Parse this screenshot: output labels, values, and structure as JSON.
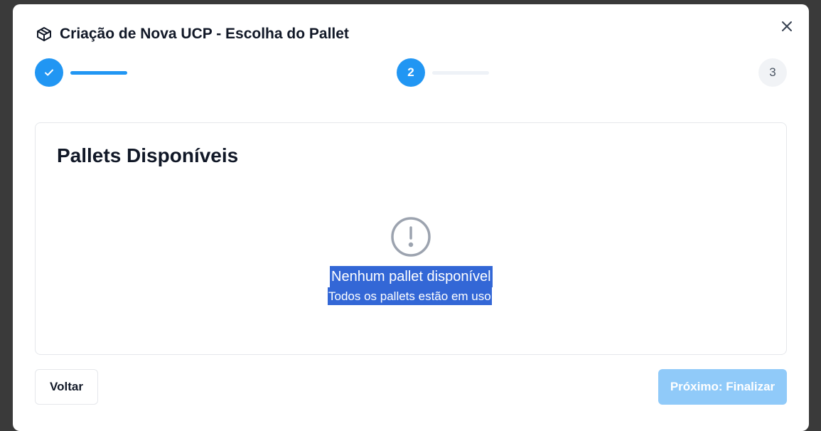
{
  "modal": {
    "title": "Criação de Nova UCP - Escolha do Pallet",
    "title_icon": "package-icon",
    "close_icon": "close-icon"
  },
  "stepper": {
    "steps": [
      {
        "label": "",
        "state": "completed",
        "icon": "check-icon"
      },
      {
        "label": "2",
        "state": "active"
      },
      {
        "label": "3",
        "state": "pending"
      }
    ],
    "progress": [
      1.0,
      0.0
    ]
  },
  "card": {
    "title": "Pallets Disponíveis",
    "empty_icon": "alert-circle-icon",
    "empty_title": "Nenhum pallet disponível",
    "empty_subtitle": "Todos os pallets estão em uso"
  },
  "footer": {
    "back_label": "Voltar",
    "next_label": "Próximo: Finalizar"
  },
  "colors": {
    "accent": "#2196f3",
    "accent_disabled": "#90caf9",
    "selection": "#3367d6"
  }
}
